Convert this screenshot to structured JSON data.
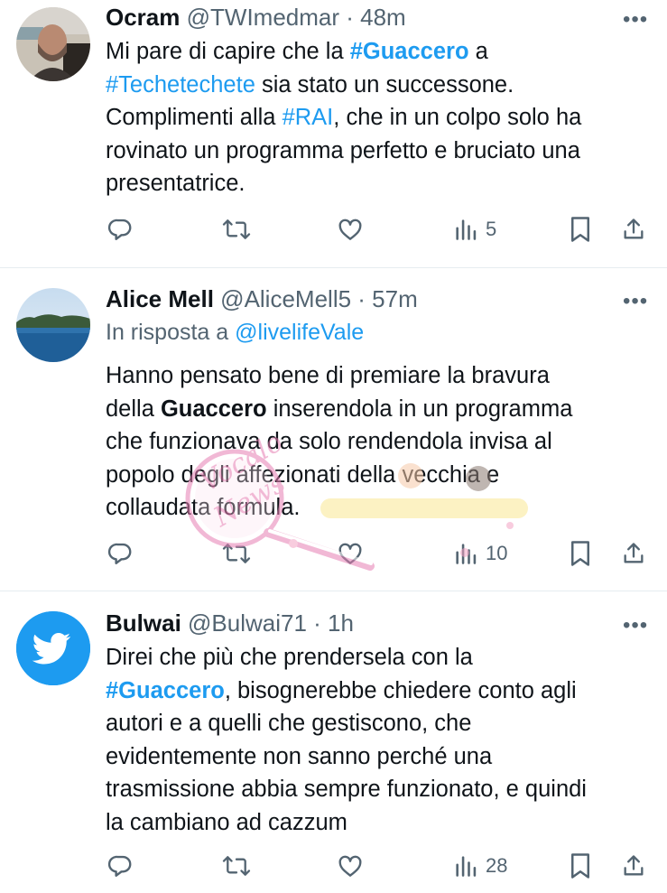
{
  "tweets": [
    {
      "name": "Ocram",
      "handle": "@TWImedmar",
      "time": "48m",
      "more": "•••",
      "lines": [
        [
          {
            "t": "Mi pare di capire che la "
          },
          {
            "t": "#Guaccero",
            "c": "tag bold"
          },
          {
            "t": " a"
          }
        ],
        [
          {
            "t": "#Techetechete",
            "c": "tag"
          },
          {
            "t": " sia stato un successone."
          }
        ],
        [
          {
            "t": "Complimenti alla "
          },
          {
            "t": "#RAI",
            "c": "tag"
          },
          {
            "t": ", che in un colpo solo ha"
          }
        ],
        [
          {
            "t": "rovinato un programma perfetto e bruciato una"
          }
        ],
        [
          {
            "t": "presentatrice."
          }
        ]
      ],
      "views": "5"
    },
    {
      "name": "Alice Mell",
      "handle": "@AliceMell5",
      "time": "57m",
      "more": "•••",
      "reply_prefix": "In risposta a ",
      "reply_to": "@livelifeVale",
      "lines": [
        [
          {
            "t": "Hanno pensato bene di premiare la bravura"
          }
        ],
        [
          {
            "t": "della "
          },
          {
            "t": "Guaccero",
            "c": "bold"
          },
          {
            "t": " inserendola in un programma"
          }
        ],
        [
          {
            "t": "che funzionava da solo rendendola invisa al"
          }
        ],
        [
          {
            "t": "popolo degli affezionati della vecchia e"
          }
        ],
        [
          {
            "t": "collaudata  formula."
          }
        ]
      ],
      "views": "10"
    },
    {
      "name": "Bulwai",
      "handle": "@Bulwai71",
      "time": "1h",
      "more": "•••",
      "lines": [
        [
          {
            "t": "Direi che più che prendersela con la"
          }
        ],
        [
          {
            "t": "#Guaccero",
            "c": "tag bold"
          },
          {
            "t": ", bisognerebbe chiedere conto agli"
          }
        ],
        [
          {
            "t": "autori e a quelli che gestiscono, che"
          }
        ],
        [
          {
            "t": "evidentemente non sanno perché una"
          }
        ],
        [
          {
            "t": "trasmissione abbia sempre funzionato, e quindi"
          }
        ],
        [
          {
            "t": "la cambiano ad cazzum"
          }
        ]
      ],
      "views": "28"
    }
  ],
  "icons": {
    "reply": "reply-icon",
    "retweet": "retweet-icon",
    "like": "heart-icon",
    "views": "views-icon",
    "bookmark": "bookmark-icon",
    "share": "share-icon"
  },
  "colors": {
    "link": "#1d9bf0",
    "secondary_text": "#536471",
    "divider": "#e6ecf0",
    "twitter_blue": "#1d9bf0"
  }
}
